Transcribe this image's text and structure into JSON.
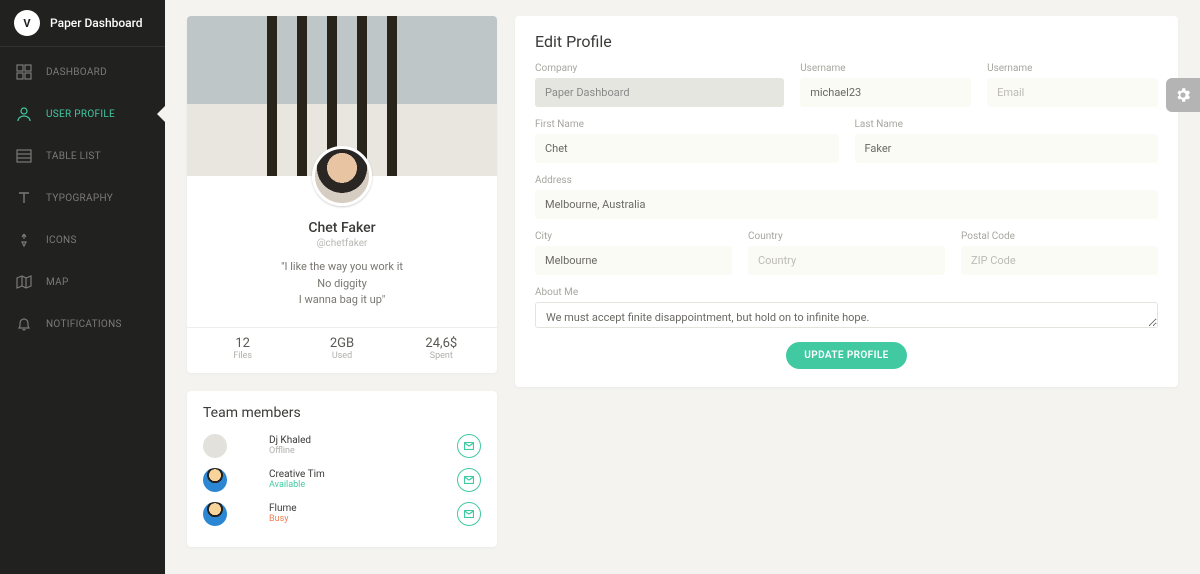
{
  "brand": {
    "name": "Paper Dashboard",
    "logo_letter": "V"
  },
  "sidebar": {
    "items": [
      {
        "label": "DASHBOARD",
        "icon": "dashboard-icon"
      },
      {
        "label": "USER PROFILE",
        "icon": "user-icon",
        "active": true
      },
      {
        "label": "TABLE LIST",
        "icon": "table-icon"
      },
      {
        "label": "TYPOGRAPHY",
        "icon": "typography-icon"
      },
      {
        "label": "ICONS",
        "icon": "icons-icon"
      },
      {
        "label": "MAP",
        "icon": "map-icon"
      },
      {
        "label": "NOTIFICATIONS",
        "icon": "bell-icon"
      }
    ]
  },
  "profile": {
    "name": "Chet Faker",
    "handle": "@chetfaker",
    "quote_l1": "\"I like the way you work it",
    "quote_l2": "No diggity",
    "quote_l3": "I wanna bag it up\"",
    "stats": [
      {
        "value": "12",
        "label": "Files"
      },
      {
        "value": "2GB",
        "label": "Used"
      },
      {
        "value": "24,6$",
        "label": "Spent"
      }
    ]
  },
  "team": {
    "title": "Team members",
    "members": [
      {
        "name": "Dj Khaled",
        "status": "Offline",
        "status_class": "st-offline",
        "avatar": "plain"
      },
      {
        "name": "Creative Tim",
        "status": "Available",
        "status_class": "st-available",
        "avatar": "cartoon"
      },
      {
        "name": "Flume",
        "status": "Busy",
        "status_class": "st-busy",
        "avatar": "cartoon"
      }
    ]
  },
  "form": {
    "title": "Edit Profile",
    "labels": {
      "company": "Company",
      "username1": "Username",
      "username2": "Username",
      "firstname": "First Name",
      "lastname": "Last Name",
      "address": "Address",
      "city": "City",
      "country": "Country",
      "postal": "Postal Code",
      "about": "About Me"
    },
    "values": {
      "company": "Paper Dashboard",
      "username": "michael23",
      "email": "",
      "firstname": "Chet",
      "lastname": "Faker",
      "address": "Melbourne, Australia",
      "city": "Melbourne",
      "country": "",
      "postal": "",
      "about": "We must accept finite disappointment, but hold on to infinite hope."
    },
    "placeholders": {
      "email": "Email",
      "country": "Country",
      "postal": "ZIP Code"
    },
    "submit": "UPDATE PROFILE"
  }
}
